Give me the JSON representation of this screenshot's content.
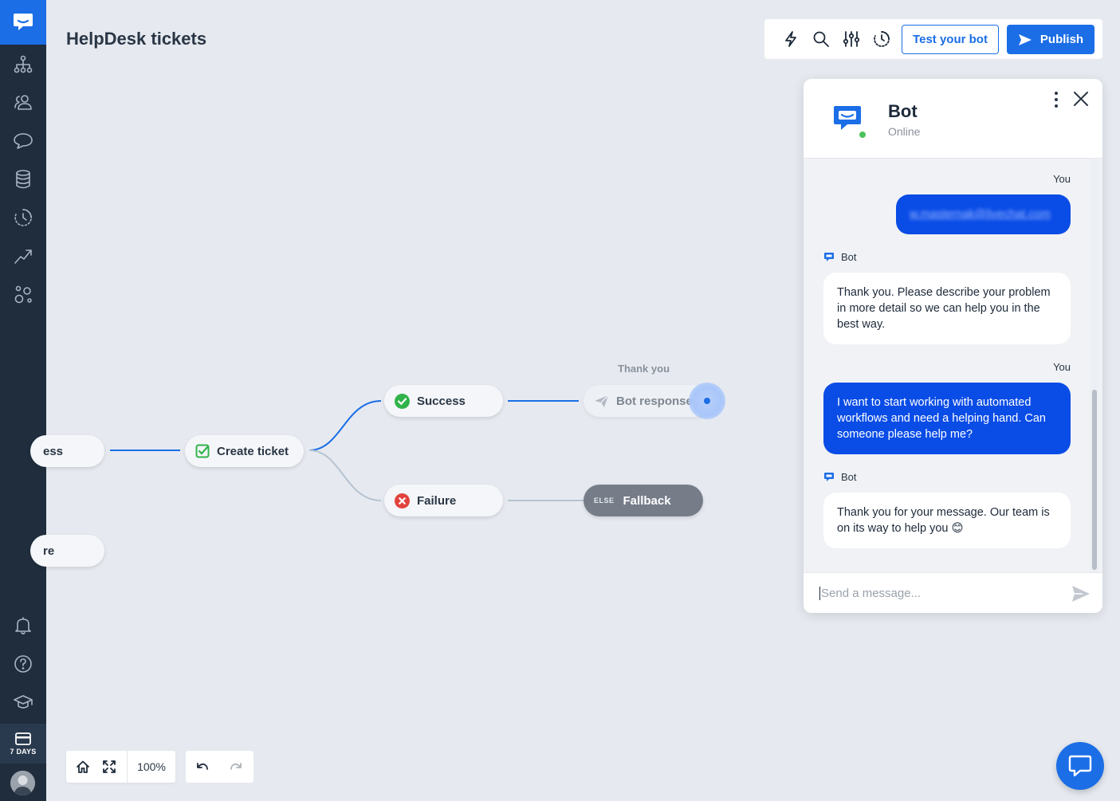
{
  "sidebar": {
    "items": [
      {
        "icon": "sitemap-icon"
      },
      {
        "icon": "users-icon"
      },
      {
        "icon": "chat-bubble-icon"
      },
      {
        "icon": "database-icon"
      },
      {
        "icon": "history-icon"
      },
      {
        "icon": "trending-up-icon"
      },
      {
        "icon": "integrations-icon"
      }
    ],
    "bottom": [
      {
        "icon": "bell-icon"
      },
      {
        "icon": "help-icon"
      },
      {
        "icon": "academy-icon"
      }
    ],
    "billing_label": "7 DAYS"
  },
  "header": {
    "title": "HelpDesk tickets",
    "test_button": "Test your bot",
    "publish_button": "Publish"
  },
  "canvas": {
    "nodes": {
      "partial_top": "ess",
      "partial_bottom": "re",
      "create_ticket": "Create ticket",
      "success": "Success",
      "failure": "Failure",
      "bot_response": "Bot response",
      "bot_response_caption": "Thank you",
      "fallback_tag": "ELSE",
      "fallback": "Fallback"
    },
    "zoom": "100%"
  },
  "chat": {
    "bot_name": "Bot",
    "status": "Online",
    "messages": [
      {
        "from": "You",
        "text": "w.masternak@livechat.com"
      },
      {
        "from": "Bot",
        "text": "Thank you. Please describe your problem in more detail so we can help you in the best way."
      },
      {
        "from": "You",
        "text": "I want to start working with automated workflows and need a helping hand. Can someone please help me?"
      },
      {
        "from": "Bot",
        "text": "Thank you for your message. Our team is on its way to help you 😊"
      }
    ],
    "input_placeholder": "Send a message..."
  },
  "colors": {
    "accent": "#1b6ee6",
    "sidebar": "#1f2d3d",
    "user_bubble": "#0a4ce6",
    "success": "#2fb34a",
    "failure": "#e2433d"
  }
}
